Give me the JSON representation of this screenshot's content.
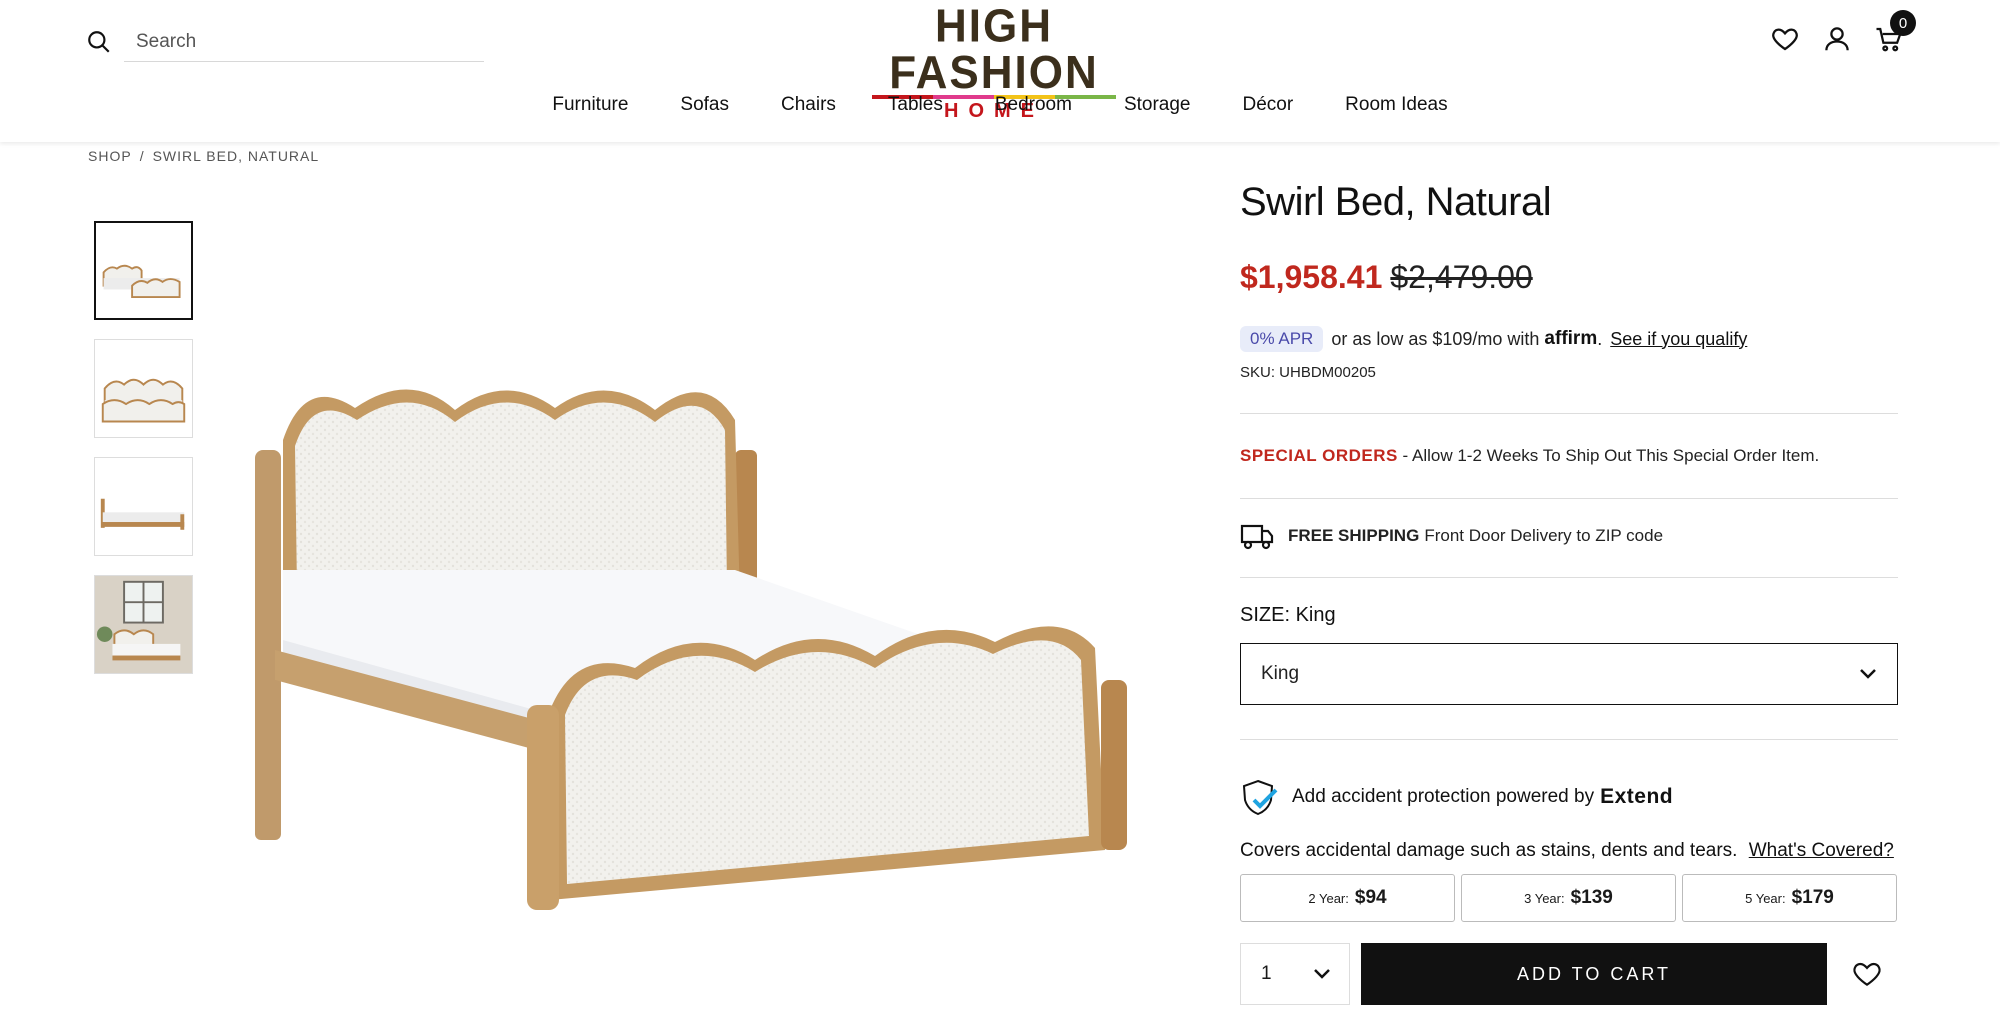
{
  "search": {
    "placeholder": "Search"
  },
  "logo": {
    "line1": "HIGH FASHION",
    "line2": "HOME"
  },
  "cart": {
    "count": "0"
  },
  "nav": [
    "Furniture",
    "Sofas",
    "Chairs",
    "Tables",
    "Bedroom",
    "Storage",
    "Décor",
    "Room Ideas"
  ],
  "breadcrumb": {
    "shop": "SHOP",
    "sep": "/",
    "current": "SWIRL BED, NATURAL"
  },
  "product": {
    "title": "Swirl Bed, Natural",
    "sale_price": "$1,958.41",
    "original_price": "$2,479.00",
    "apr_badge": "0% APR",
    "financing_text": "or as low as $109/mo with",
    "affirm_brand": "affirm",
    "qualify_link": "See if you qualify",
    "sku": "SKU: UHBDM00205",
    "special_label": "SPECIAL ORDERS",
    "special_text": " - Allow 1-2 Weeks To Ship Out This Special Order Item.",
    "shipping_bold": "FREE SHIPPING",
    "shipping_text": "Front Door Delivery to ZIP code",
    "size_label": "SIZE: King",
    "size_selected": "King"
  },
  "protection": {
    "intro": "Add accident protection powered by",
    "brand": "Extend",
    "covers_text": "Covers accidental damage such as stains, dents and tears.",
    "covers_link": "What's Covered?",
    "plans": [
      {
        "term": "2 Year:",
        "price": "$94"
      },
      {
        "term": "3 Year:",
        "price": "$139"
      },
      {
        "term": "5 Year:",
        "price": "$179"
      }
    ]
  },
  "buy": {
    "quantity": "1",
    "add_to_cart": "ADD TO CART"
  },
  "colors": {
    "sale_red": "#c0281e",
    "black": "#111111",
    "wood": "#b8874f",
    "fabric": "#f1f0ec"
  }
}
